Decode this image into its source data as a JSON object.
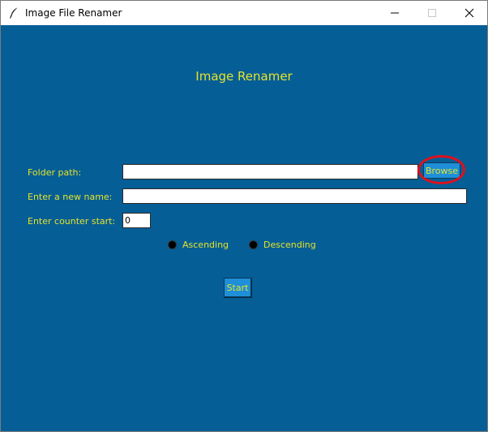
{
  "window": {
    "title": "Image File Renamer",
    "icon": "feather-icon",
    "controls": [
      "minimize-icon",
      "maximize-icon",
      "close-icon"
    ]
  },
  "main": {
    "heading": "Image Renamer",
    "folder_path": {
      "label": "Folder path:",
      "value": "",
      "browse_label": "Browse"
    },
    "new_name": {
      "label": "Enter a new name:",
      "value": ""
    },
    "counter_start": {
      "label": "Enter counter start:",
      "value": "0"
    },
    "order": {
      "options": [
        "Ascending",
        "Descending"
      ]
    },
    "start_label": "Start"
  },
  "colors": {
    "background": "#065e96",
    "text": "#e4e32a",
    "button": "#1e8fd8",
    "highlight": "#e0101e"
  }
}
